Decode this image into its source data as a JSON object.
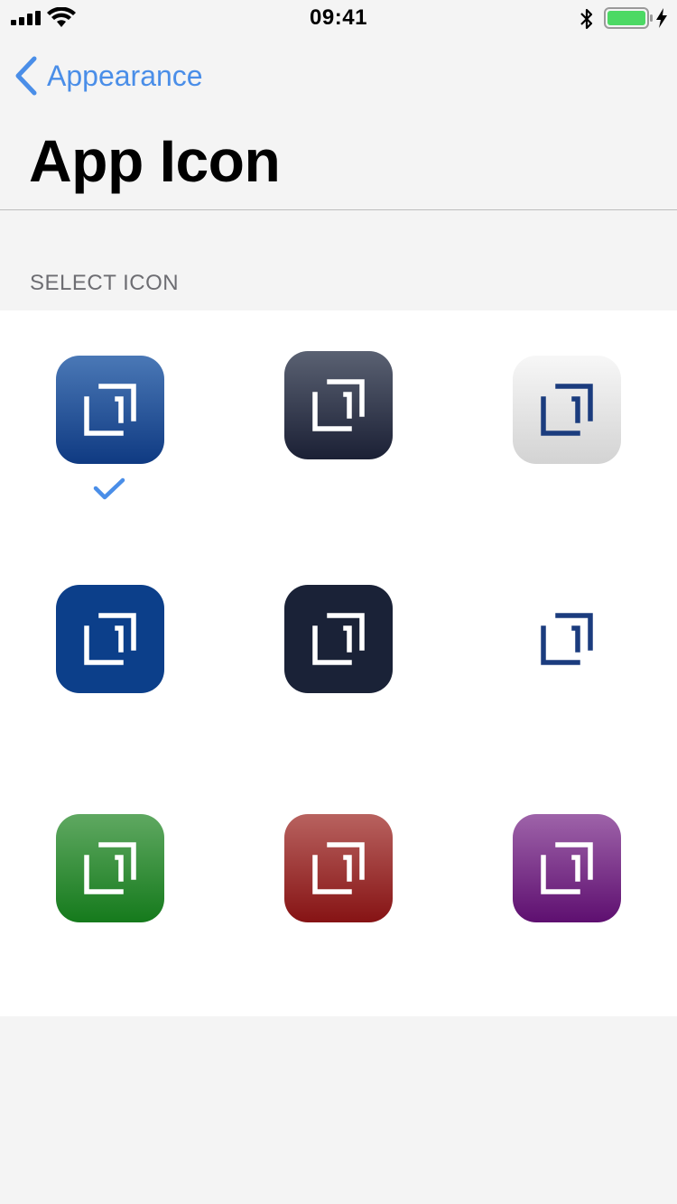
{
  "status_bar": {
    "time": "09:41",
    "icons": [
      "cellular-signal-icon",
      "wifi-icon",
      "bluetooth-icon",
      "battery-icon",
      "charging-bolt-icon"
    ]
  },
  "nav": {
    "back_label": "Appearance",
    "back_icon": "chevron-left-icon"
  },
  "page": {
    "title": "App Icon",
    "section_header": "SELECT ICON"
  },
  "colors": {
    "accent": "#4a8ee8",
    "background": "#f4f4f4",
    "panel": "#ffffff"
  },
  "icons": [
    {
      "name": "blue-gradient",
      "selected": true,
      "bg": [
        "#4a78b6",
        "#0f3a82"
      ],
      "glyph": "#ffffff"
    },
    {
      "name": "dark-gradient",
      "selected": false,
      "bg": [
        "#5a6172",
        "#1b2035"
      ],
      "glyph": "#ffffff"
    },
    {
      "name": "light-gradient",
      "selected": false,
      "bg": [
        "#f7f7f7",
        "#d3d3d3"
      ],
      "glyph": "#1b3c7e"
    },
    {
      "name": "solid-blue",
      "selected": false,
      "bg": [
        "#0c3f8a",
        "#0c3f8a"
      ],
      "glyph": "#ffffff"
    },
    {
      "name": "solid-dark",
      "selected": false,
      "bg": [
        "#1a2237",
        "#1a2237"
      ],
      "glyph": "#ffffff"
    },
    {
      "name": "plain-glyph",
      "selected": false,
      "bg": [
        "#ffffff",
        "#ffffff"
      ],
      "glyph": "#1b3c7e"
    },
    {
      "name": "green-gradient",
      "selected": false,
      "bg": [
        "#5fa861",
        "#157a1c"
      ],
      "glyph": "#ffffff"
    },
    {
      "name": "red-gradient",
      "selected": false,
      "bg": [
        "#b8625f",
        "#861314"
      ],
      "glyph": "#ffffff"
    },
    {
      "name": "purple-gradient",
      "selected": false,
      "bg": [
        "#9e63a9",
        "#5e0f70"
      ],
      "glyph": "#ffffff"
    }
  ]
}
